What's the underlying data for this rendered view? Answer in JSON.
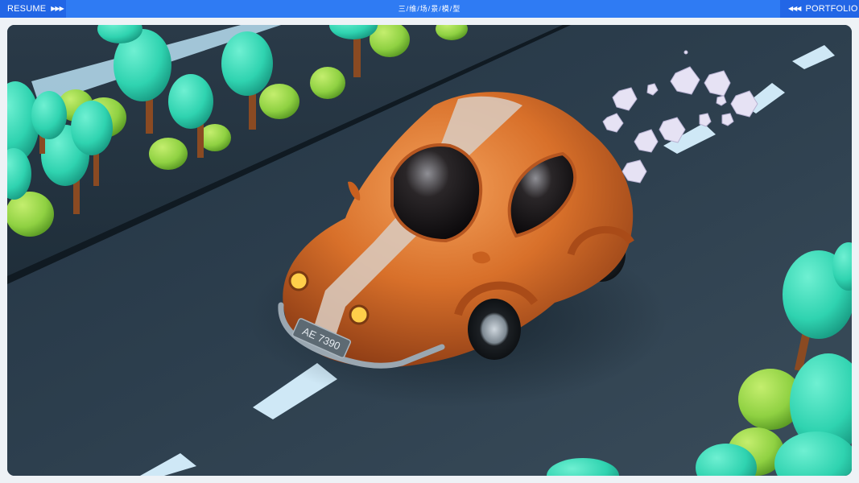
{
  "header": {
    "resume_label": "RESUME",
    "resume_arrows": "▶▶▶",
    "title": "三/维/场/景/模/型",
    "portfolio_label": "PORTFOLIO",
    "portfolio_arrows": "◀◀◀"
  },
  "scene": {
    "license_plate": "AE 7390"
  },
  "colors": {
    "header_bg": "#2f7bf3",
    "header_button_bg": "#2266e6",
    "road": "#2c3d4b",
    "car_body": "#d8702a",
    "car_stripe": "#d9c9bd",
    "tree_teal": "#2fd3b0",
    "bush_green": "#8fd142"
  }
}
